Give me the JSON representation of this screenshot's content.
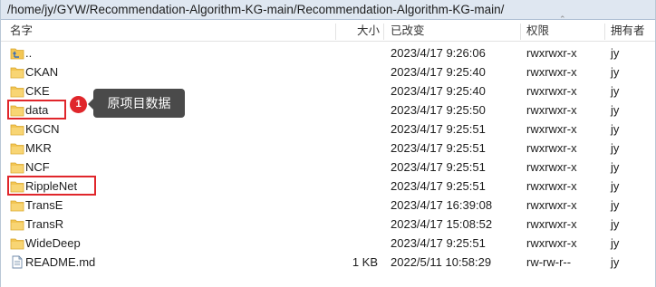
{
  "path": "/home/jy/GYW/Recommendation-Algorithm-KG-main/Recommendation-Algorithm-KG-main/",
  "columns": {
    "name": "名字",
    "size": "大小",
    "modified": "已改变",
    "permissions": "权限",
    "owner": "拥有者"
  },
  "files": [
    {
      "name": "..",
      "icon": "parent-folder-icon",
      "size": "",
      "modified": "2023/4/17 9:26:06",
      "permissions": "rwxrwxr-x",
      "owner": "jy"
    },
    {
      "name": "CKAN",
      "icon": "folder-icon",
      "size": "",
      "modified": "2023/4/17 9:25:40",
      "permissions": "rwxrwxr-x",
      "owner": "jy"
    },
    {
      "name": "CKE",
      "icon": "folder-icon",
      "size": "",
      "modified": "2023/4/17 9:25:40",
      "permissions": "rwxrwxr-x",
      "owner": "jy"
    },
    {
      "name": "data",
      "icon": "folder-icon",
      "size": "",
      "modified": "2023/4/17 9:25:50",
      "permissions": "rwxrwxr-x",
      "owner": "jy"
    },
    {
      "name": "KGCN",
      "icon": "folder-icon",
      "size": "",
      "modified": "2023/4/17 9:25:51",
      "permissions": "rwxrwxr-x",
      "owner": "jy"
    },
    {
      "name": "MKR",
      "icon": "folder-icon",
      "size": "",
      "modified": "2023/4/17 9:25:51",
      "permissions": "rwxrwxr-x",
      "owner": "jy"
    },
    {
      "name": "NCF",
      "icon": "folder-icon",
      "size": "",
      "modified": "2023/4/17 9:25:51",
      "permissions": "rwxrwxr-x",
      "owner": "jy"
    },
    {
      "name": "RippleNet",
      "icon": "folder-icon",
      "size": "",
      "modified": "2023/4/17 9:25:51",
      "permissions": "rwxrwxr-x",
      "owner": "jy"
    },
    {
      "name": "TransE",
      "icon": "folder-icon",
      "size": "",
      "modified": "2023/4/17 16:39:08",
      "permissions": "rwxrwxr-x",
      "owner": "jy"
    },
    {
      "name": "TransR",
      "icon": "folder-icon",
      "size": "",
      "modified": "2023/4/17 15:08:52",
      "permissions": "rwxrwxr-x",
      "owner": "jy"
    },
    {
      "name": "WideDeep",
      "icon": "folder-icon",
      "size": "",
      "modified": "2023/4/17 9:25:51",
      "permissions": "rwxrwxr-x",
      "owner": "jy"
    },
    {
      "name": "README.md",
      "icon": "document-icon",
      "size": "1 KB",
      "modified": "2022/5/11 10:58:29",
      "permissions": "rw-rw-r--",
      "owner": "jy"
    }
  ],
  "annotation": {
    "badge_number": "1",
    "tooltip_text": "原项目数据",
    "color": "#e0262b"
  },
  "colors": {
    "folder": "#f3c654",
    "pathbar": "#dfe7f1"
  }
}
